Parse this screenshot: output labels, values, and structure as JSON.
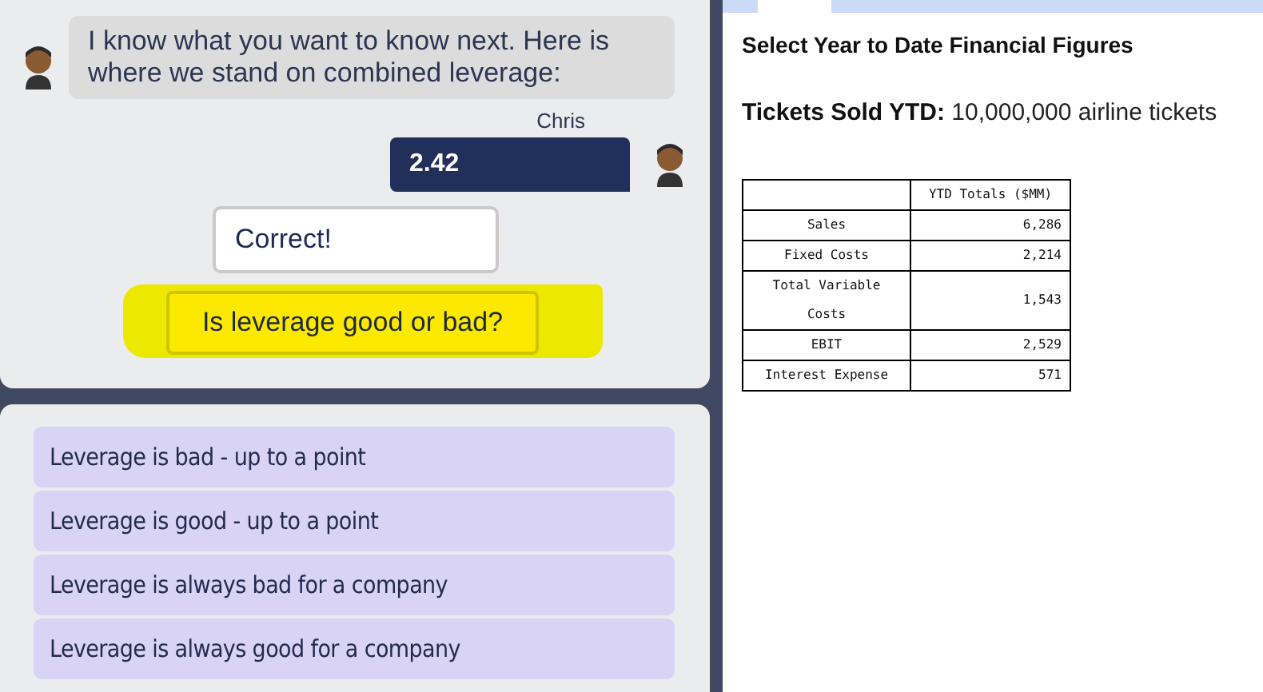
{
  "chat": {
    "messages": [
      {
        "kind": "incoming",
        "text": "I know what you want to know next. Here is where we stand on combined leverage:"
      },
      {
        "kind": "outgoing",
        "sender": "Chris",
        "text": "2.42"
      },
      {
        "kind": "feedback",
        "text": "Correct!"
      },
      {
        "kind": "prompt",
        "text": "Is leverage good or bad?"
      }
    ]
  },
  "options": [
    {
      "label": "Leverage is bad - up to a point"
    },
    {
      "label": "Leverage is good - up to a point"
    },
    {
      "label": "Leverage is always bad for a company"
    },
    {
      "label": "Leverage is always good for a company"
    }
  ],
  "panel": {
    "title": "Select Year to Date Financial Figures",
    "stat_label": "Tickets Sold YTD:",
    "stat_value": "10,000,000 airline tickets",
    "table": {
      "columns": [
        "YTD Totals ($MM)"
      ],
      "rows": [
        {
          "label": "Sales",
          "value": "6,286"
        },
        {
          "label": "Fixed Costs",
          "value": "2,214"
        },
        {
          "label": "Total Variable Costs",
          "value": "1,543"
        },
        {
          "label": "EBIT",
          "value": "2,529"
        },
        {
          "label": "Interest Expense",
          "value": "571"
        }
      ]
    }
  }
}
